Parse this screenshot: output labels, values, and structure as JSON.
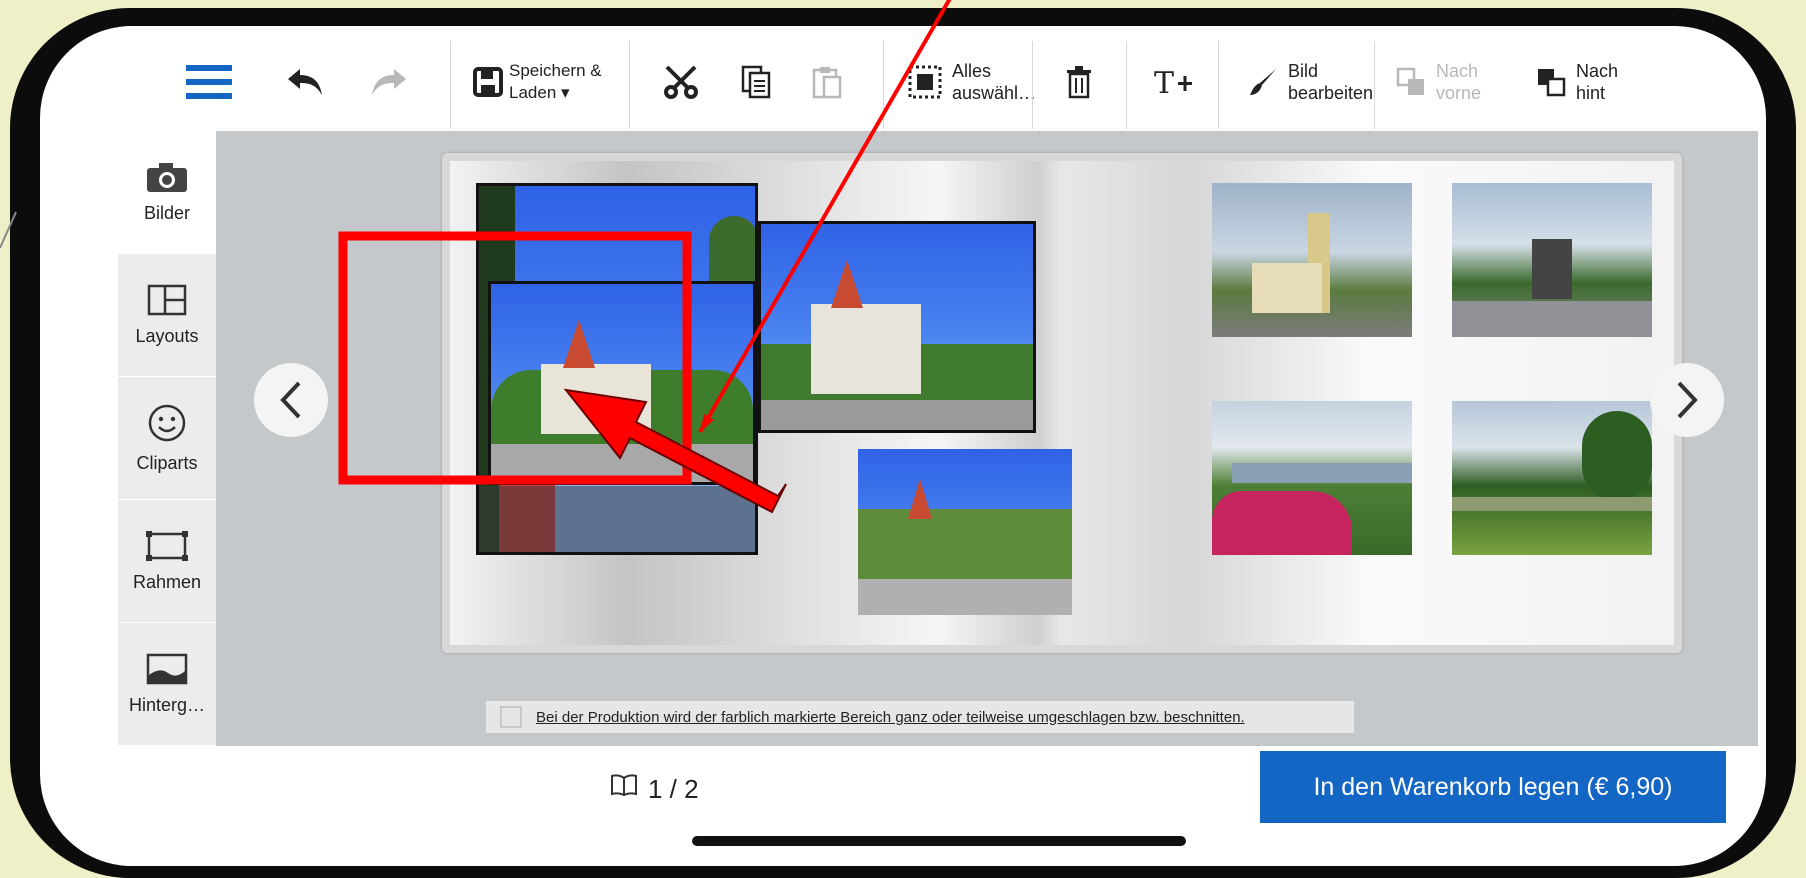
{
  "toolbar": {
    "save_load": "Speichern &\nLaden ▾",
    "select_all": "Alles\nauswähl…",
    "edit_image": "Bild\nbearbeiten",
    "bring_forward": "Nach\nvorne",
    "send_backward": "Nach\nhint"
  },
  "sidebar": {
    "items": [
      {
        "label": "Bilder",
        "icon": "camera-icon"
      },
      {
        "label": "Layouts",
        "icon": "layout-icon"
      },
      {
        "label": "Cliparts",
        "icon": "smiley-icon"
      },
      {
        "label": "Rahmen",
        "icon": "frame-icon"
      },
      {
        "label": "Hinterg…",
        "icon": "background-icon"
      }
    ]
  },
  "notice": "Bei der Produktion wird der farblich markierte Bereich ganz oder teilweise umgeschlagen bzw. beschnitten.",
  "footer": {
    "page_indicator": "1 / 2",
    "cart_button": "In den Warenkorb legen (€ 6,90)"
  },
  "colors": {
    "accent": "#1466c5",
    "annotation": "#ff0000"
  }
}
